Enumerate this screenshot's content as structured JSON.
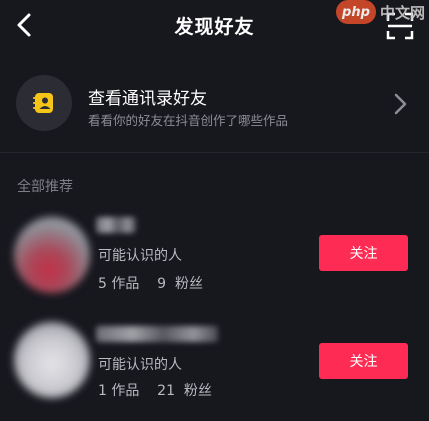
{
  "header": {
    "title": "发现好友"
  },
  "watermark": {
    "logo": "php",
    "text": "中文网"
  },
  "contacts": {
    "title": "查看通讯录好友",
    "subtitle": "看看你的好友在抖音创作了哪些作品"
  },
  "section": {
    "label": "全部推荐"
  },
  "users": [
    {
      "subtitle": "可能认识的人",
      "stats": "5 作品    9  粉丝",
      "follow_label": "关注"
    },
    {
      "subtitle": "可能认识的人",
      "stats": "1 作品    21  粉丝",
      "follow_label": "关注"
    }
  ],
  "colors": {
    "background": "#17171e",
    "accent": "#fe2c55",
    "contacts_icon": "#f5c518",
    "watermark_logo": "#d24b2b"
  },
  "icons": {
    "back": "back-arrow-icon",
    "scan": "scan-icon",
    "contacts": "contact-book-icon",
    "chevron": "chevron-right-icon"
  }
}
